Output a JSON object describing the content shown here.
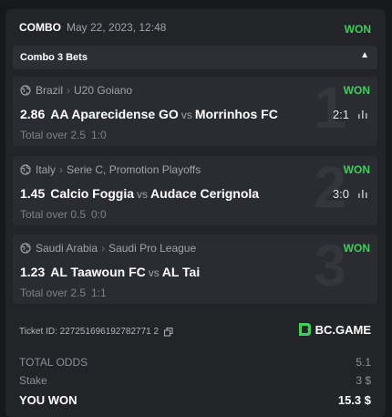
{
  "ticket": {
    "type": "COMBO",
    "date": "May 22, 2023, 12:48",
    "status": "WON",
    "collapse_label": "Combo 3 Bets",
    "bets": [
      {
        "index": "1",
        "country": "Brazil",
        "league": "U20 Goiano",
        "status": "WON",
        "odds": "2.86",
        "home": "AA Aparecidense GO",
        "vs": "vs",
        "away": "Morrinhos FC",
        "score": "2:1",
        "market": "Total over 2.5",
        "result": "1:0"
      },
      {
        "index": "2",
        "country": "Italy",
        "league": "Serie C, Promotion Playoffs",
        "status": "WON",
        "odds": "1.45",
        "home": "Calcio Foggia",
        "vs": "vs",
        "away": "Audace Cerignola",
        "score": "3:0",
        "market": "Total over 0.5",
        "result": "0:0"
      },
      {
        "index": "3",
        "country": "Saudi Arabia",
        "league": "Saudi Pro League",
        "status": "WON",
        "odds": "1.23",
        "home": "AL Taawoun FC",
        "vs": "vs",
        "away": "AL Tai",
        "score": "",
        "market": "Total over 2.5",
        "result": "1:1"
      }
    ],
    "ticket_id": "Ticket ID: 227251696192782771 2",
    "brand": "BC.GAME",
    "summary": {
      "total_odds_label": "TOTAL ODDS",
      "total_odds": "5.1",
      "stake_label": "Stake",
      "stake": "3 $",
      "won_label": "YOU WON",
      "won": "15.3 $"
    }
  },
  "colors": {
    "won": "#3cd05a",
    "card": "#232428",
    "bet_bg": "#2b2c31"
  },
  "icons": [
    "globe-icon",
    "stats-icon",
    "copy-icon",
    "bc-game-logo",
    "chevron-up-icon"
  ]
}
